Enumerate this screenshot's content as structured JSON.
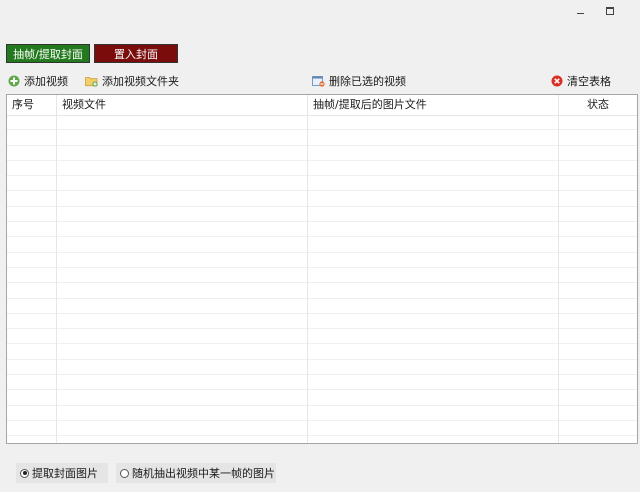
{
  "window": {
    "minimize_glyph": "minimize-icon",
    "maximize_glyph": "maximize-icon"
  },
  "tabs": [
    {
      "label": "抽帧/提取封面",
      "color": "#237a1e",
      "active": true
    },
    {
      "label": "置入封面",
      "color": "#7a0c0c",
      "active": false
    }
  ],
  "toolbar": {
    "add_video": "添加视频",
    "add_folder": "添加视频文件夹",
    "delete_selected": "删除已选的视频",
    "clear_table": "清空表格"
  },
  "table": {
    "columns": [
      "序号",
      "视频文件",
      "抽帧/提取后的图片文件",
      "状态"
    ],
    "rows": []
  },
  "options": {
    "extract_cover": "提取封面图片",
    "random_frame": "随机抽出视频中某一帧的图片",
    "selected": "extract_cover"
  }
}
